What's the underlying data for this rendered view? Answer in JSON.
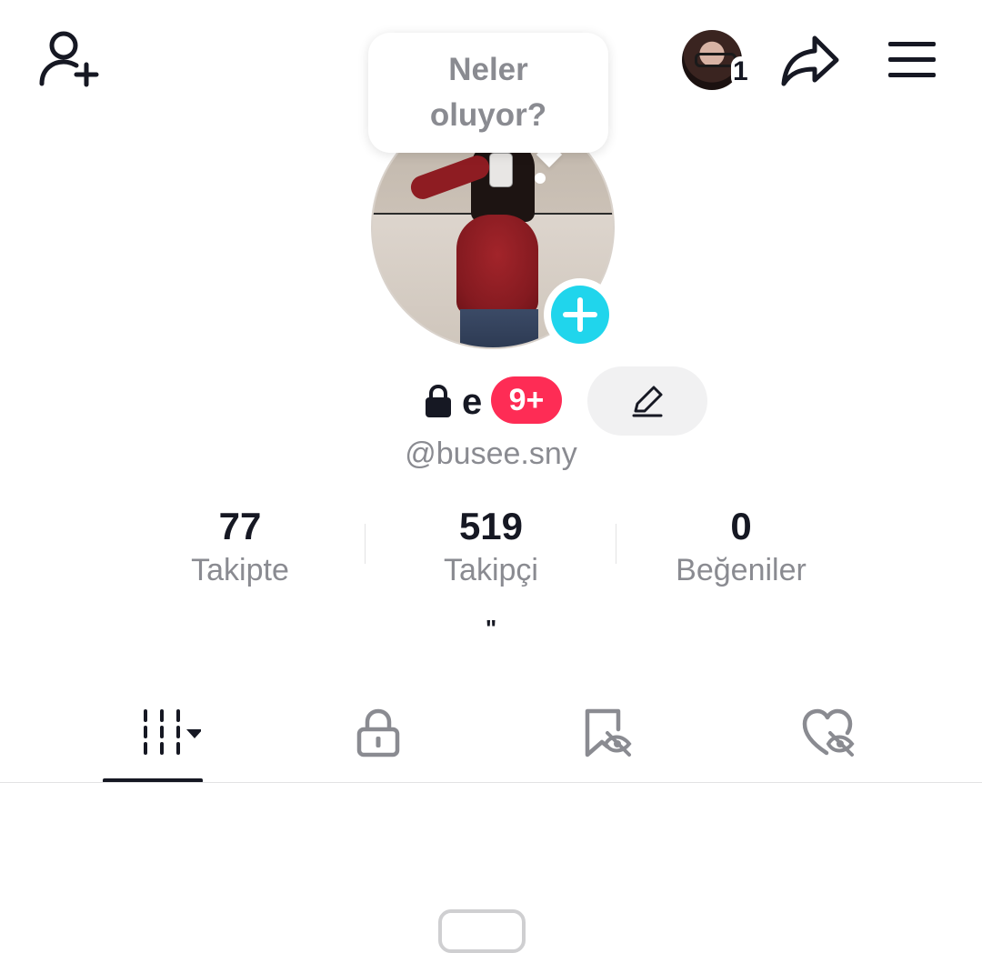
{
  "header": {
    "add_user_icon": "person-add-icon",
    "avatar_notification_count": "1",
    "share_icon": "share-arrow-icon",
    "menu_icon": "hamburger-menu-icon"
  },
  "bubble": {
    "line1": "Neler",
    "line2": "oluyor?"
  },
  "profile": {
    "name": "e",
    "badge": "9+",
    "username": "@busee.sny",
    "bio": "\""
  },
  "stats": [
    {
      "value": "77",
      "label": "Takipte"
    },
    {
      "value": "519",
      "label": "Takipçi"
    },
    {
      "value": "0",
      "label": "Beğeniler"
    }
  ],
  "tabs": [
    {
      "icon": "videos-grid-icon",
      "active": true
    },
    {
      "icon": "lock-icon",
      "active": false
    },
    {
      "icon": "bookmark-hidden-icon",
      "active": false
    },
    {
      "icon": "heart-hidden-icon",
      "active": false
    }
  ],
  "colors": {
    "accent_cyan": "#20d5ec",
    "badge_red": "#fe2c55",
    "text_dark": "#161823",
    "text_gray": "#8a8b91"
  }
}
